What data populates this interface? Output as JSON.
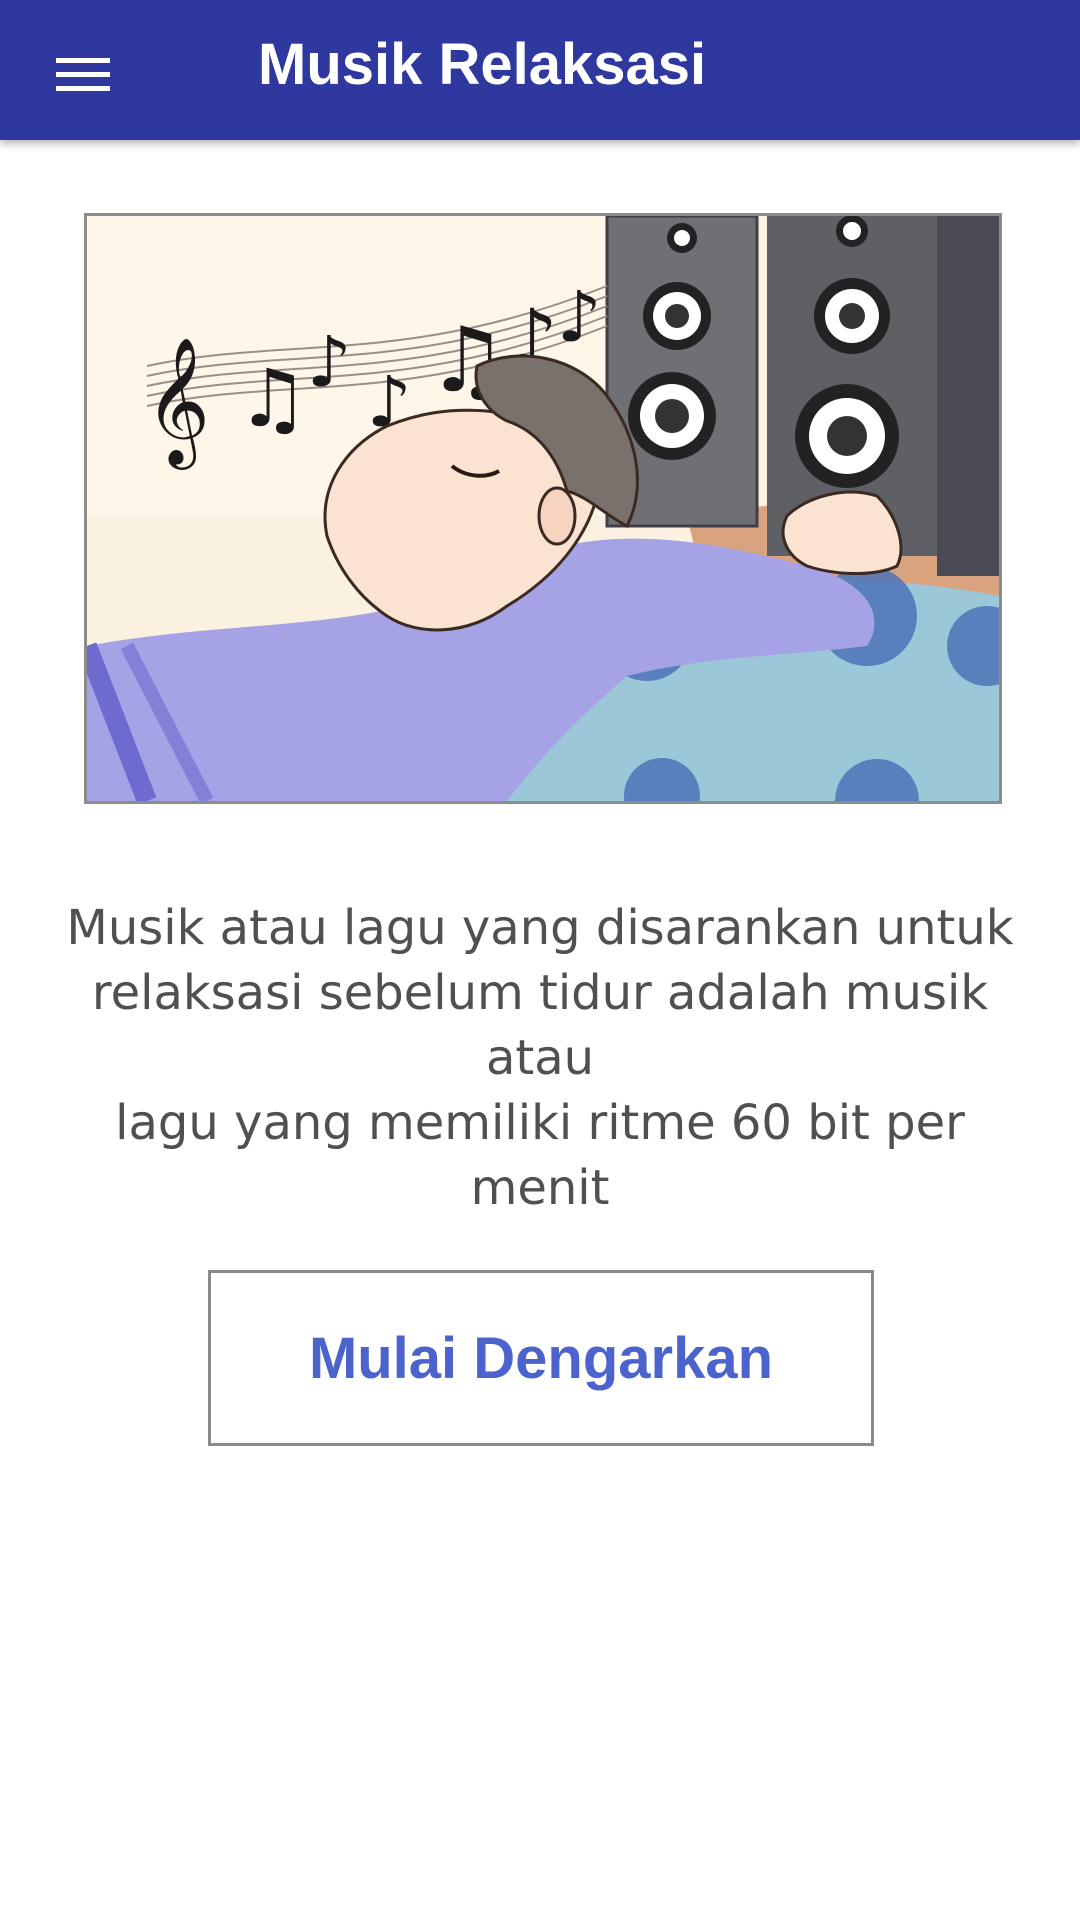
{
  "appbar": {
    "title": "Musik Relaksasi",
    "menu_icon": "hamburger-menu-icon",
    "background_color": "#2f389f"
  },
  "hero": {
    "subject": "person lying on pillow listening to music notes from speakers"
  },
  "description": {
    "lines": [
      "Musik atau lagu yang disarankan untuk",
      "relaksasi sebelum tidur adalah musik atau",
      "lagu yang memiliki ritme 60 bit per menit"
    ]
  },
  "cta": {
    "label": "Mulai Dengarkan",
    "color": "#4c62cc"
  }
}
